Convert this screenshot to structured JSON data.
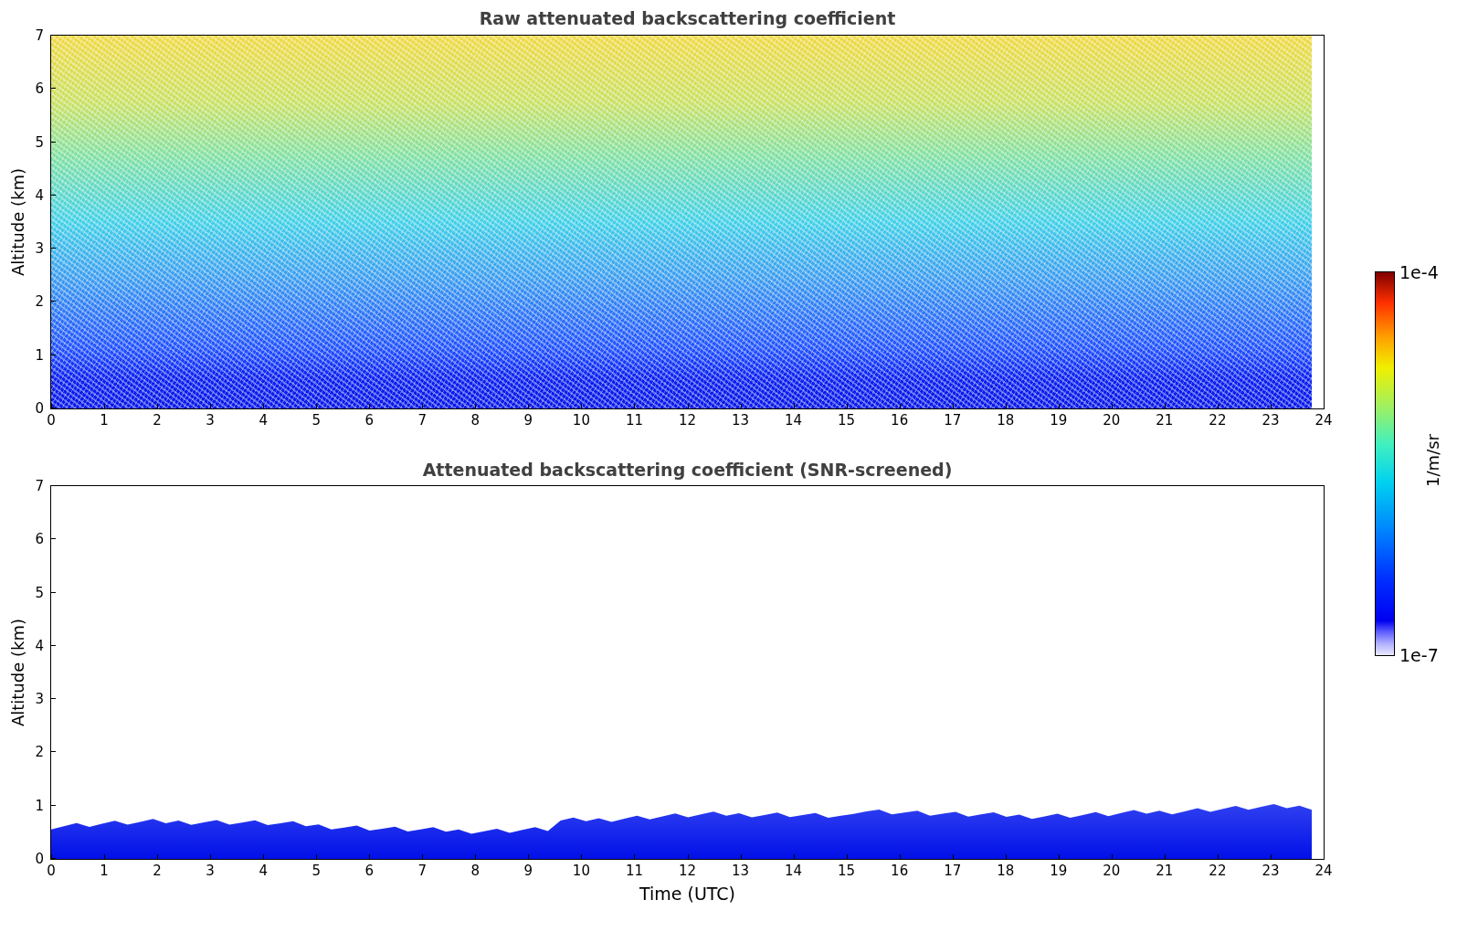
{
  "panels": [
    {
      "title": "Raw attenuated backscattering coefficient",
      "ylabel": "Altitude (km)",
      "kind": "raw",
      "yticks": [
        "7",
        "6",
        "5",
        "4",
        "3",
        "2",
        "1",
        "0"
      ],
      "xticks": [
        "0",
        "1",
        "2",
        "3",
        "4",
        "5",
        "6",
        "7",
        "8",
        "9",
        "10",
        "11",
        "12",
        "13",
        "14",
        "15",
        "16",
        "17",
        "18",
        "19",
        "20",
        "21",
        "22",
        "23",
        "24"
      ]
    },
    {
      "title": "Attenuated backscattering coefficient (SNR-screened)",
      "ylabel": "Altitude (km)",
      "kind": "screened",
      "yticks": [
        "7",
        "6",
        "5",
        "4",
        "3",
        "2",
        "1",
        "0"
      ],
      "xticks": [
        "0",
        "1",
        "2",
        "3",
        "4",
        "5",
        "6",
        "7",
        "8",
        "9",
        "10",
        "11",
        "12",
        "13",
        "14",
        "15",
        "16",
        "17",
        "18",
        "19",
        "20",
        "21",
        "22",
        "23",
        "24"
      ],
      "xlabel": "Time (UTC)"
    }
  ],
  "colorbar": {
    "label": "1/m/sr",
    "max": "1e-4",
    "min": "1e-7"
  }
}
